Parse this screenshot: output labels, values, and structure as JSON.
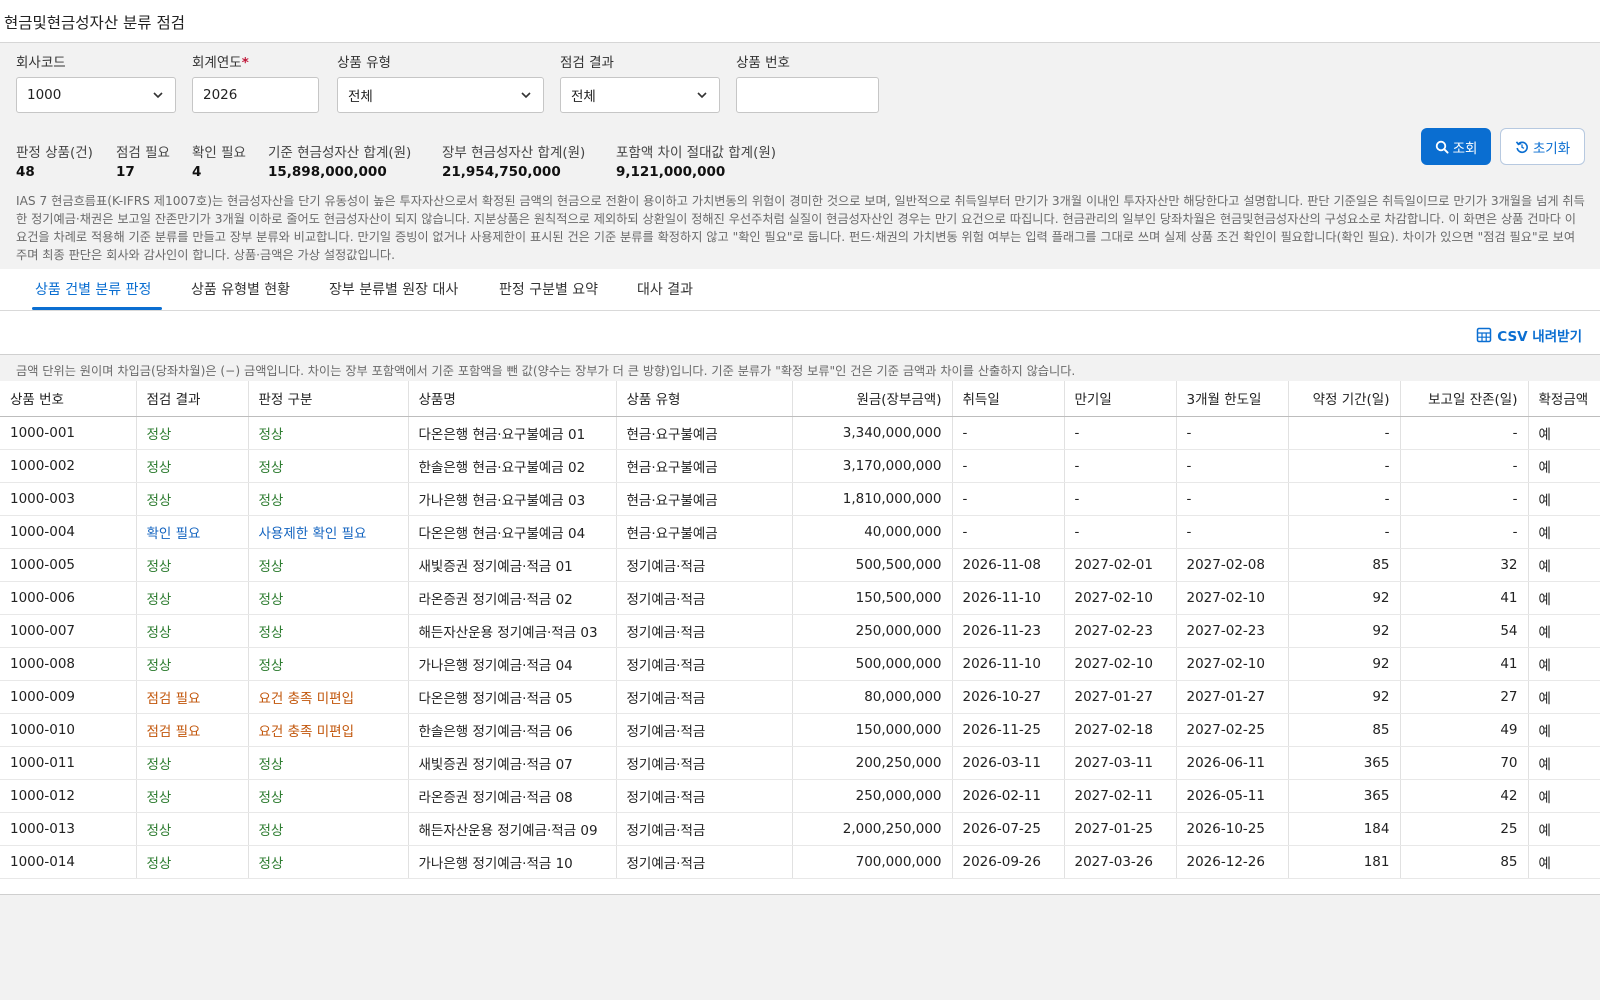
{
  "header": {
    "title": "현금및현금성자산 분류 점검"
  },
  "filters": {
    "company_code": {
      "label": "회사코드",
      "value": "1000"
    },
    "fiscal_year": {
      "label": "회계연도",
      "required_mark": "*",
      "value": "2026"
    },
    "product_type": {
      "label": "상품 유형",
      "value": "전체"
    },
    "check_result": {
      "label": "점검 결과",
      "value": "전체"
    },
    "product_no": {
      "label": "상품 번호",
      "value": ""
    }
  },
  "buttons": {
    "search": "조회",
    "reset": "초기화",
    "csv": "CSV 내려받기"
  },
  "kpis": [
    {
      "label": "판정 상품(건)",
      "value": "48"
    },
    {
      "label": "점검 필요",
      "value": "17"
    },
    {
      "label": "확인 필요",
      "value": "4"
    },
    {
      "label": "기준 현금성자산 합계(원)",
      "value": "15,898,000,000"
    },
    {
      "label": "장부 현금성자산 합계(원)",
      "value": "21,954,750,000"
    },
    {
      "label": "포함액 차이 절대값 합계(원)",
      "value": "9,121,000,000"
    }
  ],
  "description": "IAS 7 현금흐름표(K-IFRS 제1007호)는 현금성자산을 단기 유동성이 높은 투자자산으로서 확정된 금액의 현금으로 전환이 용이하고 가치변동의 위험이 경미한 것으로 보며, 일반적으로 취득일부터 만기가 3개월 이내인 투자자산만 해당한다고 설명합니다. 판단 기준일은 취득일이므로 만기가 3개월을 넘게 취득한 정기예금·채권은 보고일 잔존만기가 3개월 이하로 줄어도 현금성자산이 되지 않습니다. 지분상품은 원칙적으로 제외하되 상환일이 정해진 우선주처럼 실질이 현금성자산인 경우는 만기 요건으로 따집니다. 현금관리의 일부인 당좌차월은 현금및현금성자산의 구성요소로 차감합니다. 이 화면은 상품 건마다 이 요건을 차례로 적용해 기준 분류를 만들고 장부 분류와 비교합니다. 만기일 증빙이 없거나 사용제한이 표시된 건은 기준 분류를 확정하지 않고 \"확인 필요\"로 둡니다. 펀드·채권의 가치변동 위험 여부는 입력 플래그를 그대로 쓰며 실제 상품 조건 확인이 필요합니다(확인 필요). 차이가 있으면 \"점검 필요\"로 보여 주며 최종 판단은 회사와 감사인이 합니다. 상품·금액은 가상 설정값입니다.",
  "tabs": [
    {
      "label": "상품 건별 분류 판정",
      "active": true
    },
    {
      "label": "상품 유형별 현황",
      "active": false
    },
    {
      "label": "장부 분류별 원장 대사",
      "active": false
    },
    {
      "label": "판정 구분별 요약",
      "active": false
    },
    {
      "label": "대사 결과",
      "active": false
    }
  ],
  "note": "금액 단위는 원이며 차입금(당좌차월)은 (−) 금액입니다. 차이는 장부 포함액에서 기준 포함액을 뺀 값(양수는 장부가 더 큰 방향)입니다. 기준 분류가 \"확정 보류\"인 건은 기준 금액과 차이를 산출하지 않습니다.",
  "table": {
    "columns": [
      "상품 번호",
      "점검 결과",
      "판정 구분",
      "상품명",
      "상품 유형",
      "원금(장부금액)",
      "취득일",
      "만기일",
      "3개월 한도일",
      "약정 기간(일)",
      "보고일 잔존(일)",
      "확정금액"
    ],
    "rows": [
      [
        "1000-001",
        "정상",
        "정상",
        "다온은행 현금·요구불예금 01",
        "현금·요구불예금",
        "3,340,000,000",
        "-",
        "-",
        "-",
        "-",
        "-",
        "예"
      ],
      [
        "1000-002",
        "정상",
        "정상",
        "한솔은행 현금·요구불예금 02",
        "현금·요구불예금",
        "3,170,000,000",
        "-",
        "-",
        "-",
        "-",
        "-",
        "예"
      ],
      [
        "1000-003",
        "정상",
        "정상",
        "가나은행 현금·요구불예금 03",
        "현금·요구불예금",
        "1,810,000,000",
        "-",
        "-",
        "-",
        "-",
        "-",
        "예"
      ],
      [
        "1000-004",
        "확인 필요",
        "사용제한 확인 필요",
        "다온은행 현금·요구불예금 04",
        "현금·요구불예금",
        "40,000,000",
        "-",
        "-",
        "-",
        "-",
        "-",
        "예"
      ],
      [
        "1000-005",
        "정상",
        "정상",
        "새빛증권 정기예금·적금 01",
        "정기예금·적금",
        "500,500,000",
        "2026-11-08",
        "2027-02-01",
        "2027-02-08",
        "85",
        "32",
        "예"
      ],
      [
        "1000-006",
        "정상",
        "정상",
        "라온증권 정기예금·적금 02",
        "정기예금·적금",
        "150,500,000",
        "2026-11-10",
        "2027-02-10",
        "2027-02-10",
        "92",
        "41",
        "예"
      ],
      [
        "1000-007",
        "정상",
        "정상",
        "해든자산운용 정기예금·적금 03",
        "정기예금·적금",
        "250,000,000",
        "2026-11-23",
        "2027-02-23",
        "2027-02-23",
        "92",
        "54",
        "예"
      ],
      [
        "1000-008",
        "정상",
        "정상",
        "가나은행 정기예금·적금 04",
        "정기예금·적금",
        "500,000,000",
        "2026-11-10",
        "2027-02-10",
        "2027-02-10",
        "92",
        "41",
        "예"
      ],
      [
        "1000-009",
        "점검 필요",
        "요건 충족 미편입",
        "다온은행 정기예금·적금 05",
        "정기예금·적금",
        "80,000,000",
        "2026-10-27",
        "2027-01-27",
        "2027-01-27",
        "92",
        "27",
        "예"
      ],
      [
        "1000-010",
        "점검 필요",
        "요건 충족 미편입",
        "한솔은행 정기예금·적금 06",
        "정기예금·적금",
        "150,000,000",
        "2026-11-25",
        "2027-02-18",
        "2027-02-25",
        "85",
        "49",
        "예"
      ],
      [
        "1000-011",
        "정상",
        "정상",
        "새빛증권 정기예금·적금 07",
        "정기예금·적금",
        "200,250,000",
        "2026-03-11",
        "2027-03-11",
        "2026-06-11",
        "365",
        "70",
        "예"
      ],
      [
        "1000-012",
        "정상",
        "정상",
        "라온증권 정기예금·적금 08",
        "정기예금·적금",
        "250,000,000",
        "2026-02-11",
        "2027-02-11",
        "2026-05-11",
        "365",
        "42",
        "예"
      ],
      [
        "1000-013",
        "정상",
        "정상",
        "해든자산운용 정기예금·적금 09",
        "정기예금·적금",
        "2,000,250,000",
        "2026-07-25",
        "2027-01-25",
        "2026-10-25",
        "184",
        "25",
        "예"
      ],
      [
        "1000-014",
        "정상",
        "정상",
        "가나은행 정기예금·적금 10",
        "정기예금·적금",
        "700,000,000",
        "2026-09-26",
        "2027-03-26",
        "2026-12-26",
        "181",
        "85",
        "예"
      ]
    ]
  },
  "status_colors": {
    "정상": "#2f7d32",
    "확인 필요": "#1565c0",
    "점검 필요": "#c2570c"
  },
  "icons": {
    "dropdown": "chevron-down-icon",
    "search": "search-icon",
    "reset": "reset-icon",
    "csv": "spreadsheet-icon"
  }
}
